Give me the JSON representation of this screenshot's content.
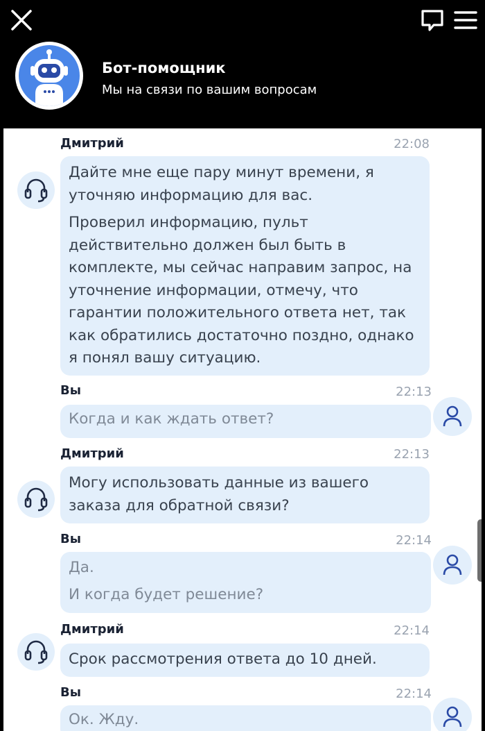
{
  "header": {
    "bot_name": "Бот-помощник",
    "bot_subtitle": "Мы на связи по вашим вопросам"
  },
  "icons": {
    "close": "close-icon",
    "chat": "chat-bubble-icon",
    "menu": "hamburger-menu-icon",
    "avatar": "robot-avatar-icon",
    "agent": "headset-icon",
    "user": "user-person-icon"
  },
  "colors": {
    "header_bg": "#000000",
    "bubble_bg": "#e3effb",
    "accent": "#2a4aa6",
    "avatar_blue": "#4a86e8"
  },
  "messages": [
    {
      "sender": "Дмитрий",
      "time": "22:08",
      "paragraphs": [
        "Дайте мне еще пару минут времени, я уточняю информацию для вас.",
        "Проверил информацию, пульт действительно должен был быть в комплекте, мы сейчас направим запрос, на уточнение информации, отмечу, что гарантии положительного ответа нет, так как обратились достаточно поздно, однако я понял вашу ситуацию."
      ]
    },
    {
      "sender": "Вы",
      "time": "22:13",
      "paragraphs": [
        "Когда и как ждать ответ?"
      ]
    },
    {
      "sender": "Дмитрий",
      "time": "22:13",
      "paragraphs": [
        "Могу использовать данные из вашего заказа для обратной связи?"
      ]
    },
    {
      "sender": "Вы",
      "time": "22:14",
      "paragraphs": [
        "Да.",
        "И когда будет решение?"
      ]
    },
    {
      "sender": "Дмитрий",
      "time": "22:14",
      "paragraphs": [
        "Срок рассмотрения ответа до 10 дней."
      ]
    },
    {
      "sender": "Вы",
      "time": "22:14",
      "paragraphs": [
        "Ок. Жду."
      ]
    }
  ]
}
